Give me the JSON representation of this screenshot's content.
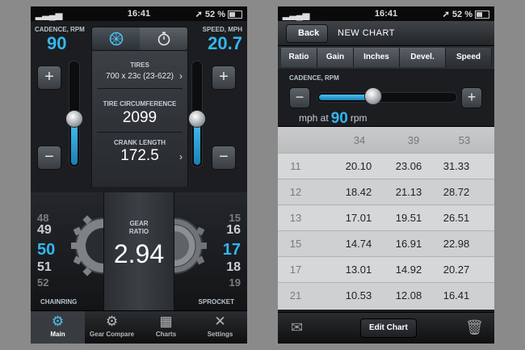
{
  "colors": {
    "accent": "#34b6ef",
    "background": "#8a8a8a"
  },
  "status_bar": {
    "time": "16:41",
    "battery": "52 %"
  },
  "main_screen": {
    "cadence_label": "CADENCE, RPM",
    "cadence_value": "90",
    "speed_label": "SPEED, MPH",
    "speed_value": "20.7",
    "mode_icons": [
      "wheel-icon",
      "stopwatch-icon"
    ],
    "tires_label": "TIRES",
    "tires_value": "700 x 23c (23-622)",
    "circumference_label": "TIRE CIRCUMFERENCE",
    "circumference_value": "2099",
    "crank_label": "CRANK LENGTH",
    "crank_value": "172.5",
    "cadence_slider_level": 0.45,
    "speed_slider_level": 0.45,
    "chainring_numbers": [
      "48",
      "49",
      "50",
      "51",
      "52"
    ],
    "chainring_selected": "50",
    "sprocket_numbers": [
      "15",
      "16",
      "17",
      "18",
      "19"
    ],
    "sprocket_selected": "17",
    "gear_ratio_label_1": "GEAR",
    "gear_ratio_label_2": "RATIO",
    "gear_ratio_value": "2.94",
    "chainring_label": "CHAINRING",
    "sprocket_label": "SPROCKET",
    "tabs": [
      {
        "label": "Main",
        "icon": "gear-icon"
      },
      {
        "label": "Gear Compare",
        "icon": "gears-compare-icon"
      },
      {
        "label": "Charts",
        "icon": "chart-icon"
      },
      {
        "label": "Settings",
        "icon": "tools-icon"
      }
    ]
  },
  "chart_screen": {
    "back_label": "Back",
    "title": "NEW CHART",
    "segments": [
      "Ratio",
      "Gain",
      "Inches",
      "Devel.",
      "Speed"
    ],
    "active_segment": "Speed",
    "cadence_label": "CADENCE, RPM",
    "cadence_slider_level": 0.4,
    "rpm_prefix": "mph at",
    "rpm_value": "90",
    "rpm_suffix": "rpm",
    "columns": [
      "34",
      "39",
      "53"
    ],
    "rows": [
      {
        "cog": "11",
        "values": [
          "20.10",
          "23.06",
          "31.33"
        ]
      },
      {
        "cog": "12",
        "values": [
          "18.42",
          "21.13",
          "28.72"
        ]
      },
      {
        "cog": "13",
        "values": [
          "17.01",
          "19.51",
          "26.51"
        ]
      },
      {
        "cog": "15",
        "values": [
          "14.74",
          "16.91",
          "22.98"
        ]
      },
      {
        "cog": "17",
        "values": [
          "13.01",
          "14.92",
          "20.27"
        ]
      },
      {
        "cog": "21",
        "values": [
          "10.53",
          "12.08",
          "16.41"
        ]
      }
    ],
    "edit_label": "Edit Chart"
  }
}
